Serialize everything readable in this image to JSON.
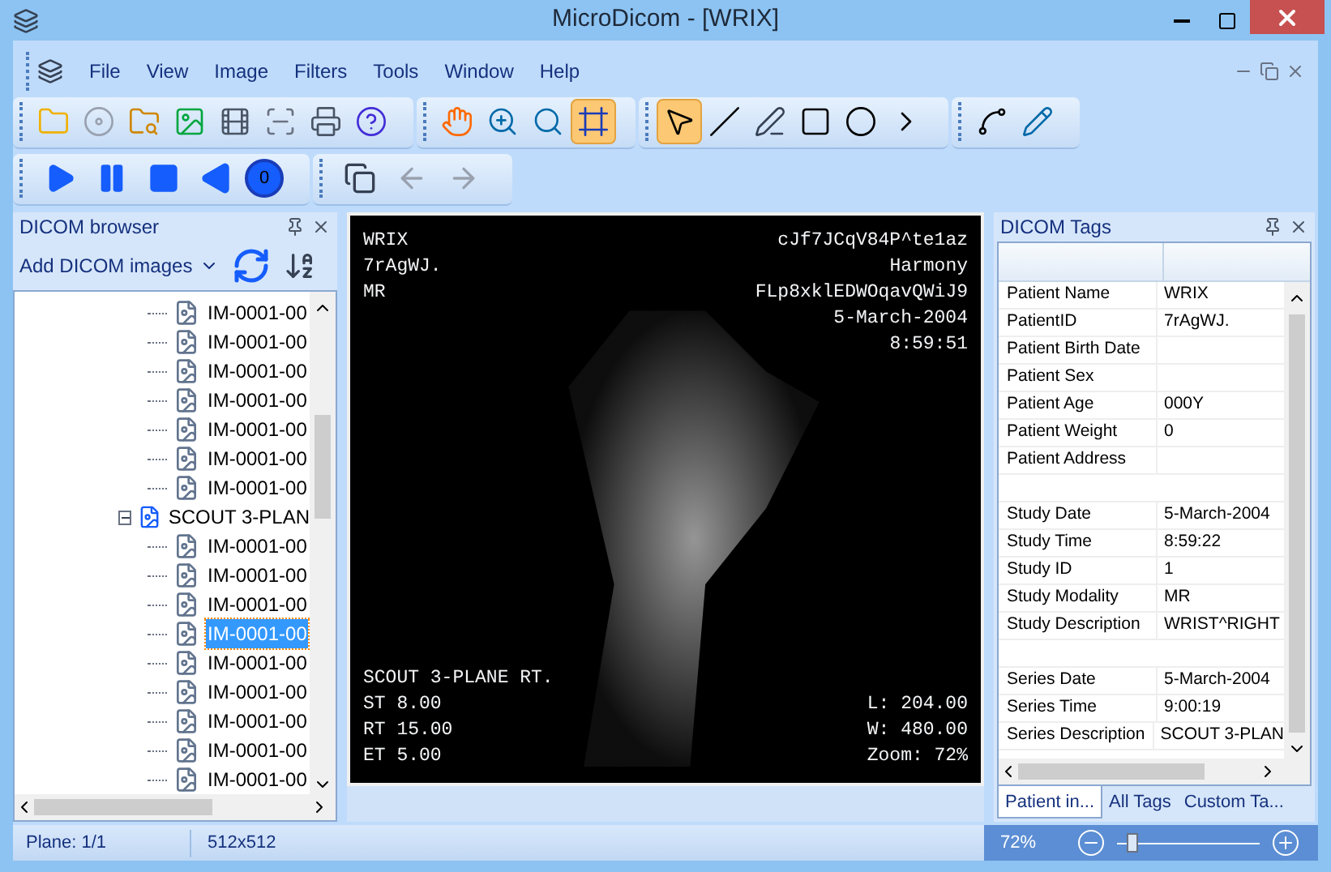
{
  "window": {
    "title": "MicroDicom - [WRIX]"
  },
  "menu": [
    "File",
    "View",
    "Image",
    "Filters",
    "Tools",
    "Window",
    "Help"
  ],
  "toolbar": [
    {
      "selected": false
    },
    {
      "selected": false
    },
    {
      "selected": false
    },
    {
      "selected": false
    },
    {
      "selected": false
    },
    {
      "selected": false
    },
    {
      "selected": false
    },
    {
      "selected": false
    },
    {
      "selected": false
    },
    {
      "selected": false
    },
    {
      "selected": false
    },
    {
      "selected": true
    },
    {
      "selected": true
    },
    {
      "selected": false
    },
    {
      "selected": false
    },
    {
      "selected": false
    },
    {
      "selected": false
    },
    {
      "selected": false
    },
    {
      "selected": false
    },
    {
      "selected": false
    }
  ],
  "playback": {
    "counter": "0"
  },
  "nav": [
    {
      "disabled": false
    },
    {
      "disabled": true
    },
    {
      "disabled": true
    }
  ],
  "browser": {
    "title": "DICOM browser",
    "add_button": "Add DICOM images",
    "tree": [
      {
        "children": [
          {
            "label": "IM-0001-00",
            "selected": false
          },
          {
            "label": "IM-0001-00",
            "selected": false
          },
          {
            "label": "IM-0001-00",
            "selected": false
          },
          {
            "label": "IM-0001-00",
            "selected": false
          },
          {
            "label": "IM-0001-00",
            "selected": false
          },
          {
            "label": "IM-0001-00",
            "selected": false
          },
          {
            "label": "IM-0001-00",
            "selected": false
          }
        ]
      },
      {
        "label": "SCOUT 3-PLAN",
        "expanded": true,
        "children": [
          {
            "label": "IM-0001-00",
            "selected": false
          },
          {
            "label": "IM-0001-00",
            "selected": false
          },
          {
            "label": "IM-0001-00",
            "selected": false
          },
          {
            "label": "IM-0001-00",
            "selected": true
          },
          {
            "label": "IM-0001-00",
            "selected": false
          },
          {
            "label": "IM-0001-00",
            "selected": false
          },
          {
            "label": "IM-0001-00",
            "selected": false
          },
          {
            "label": "IM-0001-00",
            "selected": false
          },
          {
            "label": "IM-0001-00",
            "selected": false
          }
        ]
      }
    ]
  },
  "viewer": {
    "top_left": [
      "WRIX",
      "7rAgWJ.",
      "MR"
    ],
    "top_right": [
      "cJf7JCqV84P^te1az",
      "Harmony",
      "FLp8xklEDWOqavQWiJ9",
      "5-March-2004",
      "8:59:51"
    ],
    "bottom_left": [
      "SCOUT 3-PLANE RT.",
      "ST 8.00",
      "RT 15.00",
      "ET 5.00"
    ],
    "bottom_right": [
      "L: 204.00",
      "W: 480.00",
      "Zoom: 72%"
    ]
  },
  "tags": {
    "title": "DICOM Tags",
    "rows": [
      {
        "kind": "tag",
        "name": "Patient Name",
        "value": "WRIX"
      },
      {
        "kind": "tag",
        "name": "PatientID",
        "value": "7rAgWJ."
      },
      {
        "kind": "tag",
        "name": "Patient Birth Date"
      },
      {
        "kind": "tag",
        "name": "Patient Sex"
      },
      {
        "kind": "tag",
        "name": "Patient Age",
        "value": "000Y"
      },
      {
        "kind": "tag",
        "name": "Patient Weight",
        "value": "0"
      },
      {
        "kind": "tag",
        "name": "Patient Address"
      },
      {
        "kind": "spacer"
      },
      {
        "kind": "tag",
        "name": "Study Date",
        "value": "5-March-2004"
      },
      {
        "kind": "tag",
        "name": "Study Time",
        "value": "8:59:22"
      },
      {
        "kind": "tag",
        "name": "Study ID",
        "value": "1"
      },
      {
        "kind": "tag",
        "name": "Study Modality",
        "value": "MR"
      },
      {
        "kind": "tag",
        "name": "Study Description",
        "value": "WRIST^RIGHT"
      },
      {
        "kind": "spacer"
      },
      {
        "kind": "tag",
        "name": "Series Date",
        "value": "5-March-2004"
      },
      {
        "kind": "tag",
        "name": "Series Time",
        "value": "9:00:19"
      },
      {
        "kind": "tag",
        "name": "Series Description",
        "value": "SCOUT 3-PLAN"
      }
    ],
    "tabs": [
      {
        "label": "Patient in...",
        "selected": true
      },
      {
        "label": "All Tags",
        "selected": false
      },
      {
        "label": "Custom Ta...",
        "selected": false
      }
    ]
  },
  "status_bar": {
    "plane": "Plane: 1/1",
    "size": "512x512",
    "zoom": "72%",
    "zoom_slider": {
      "level": 0.1
    }
  }
}
